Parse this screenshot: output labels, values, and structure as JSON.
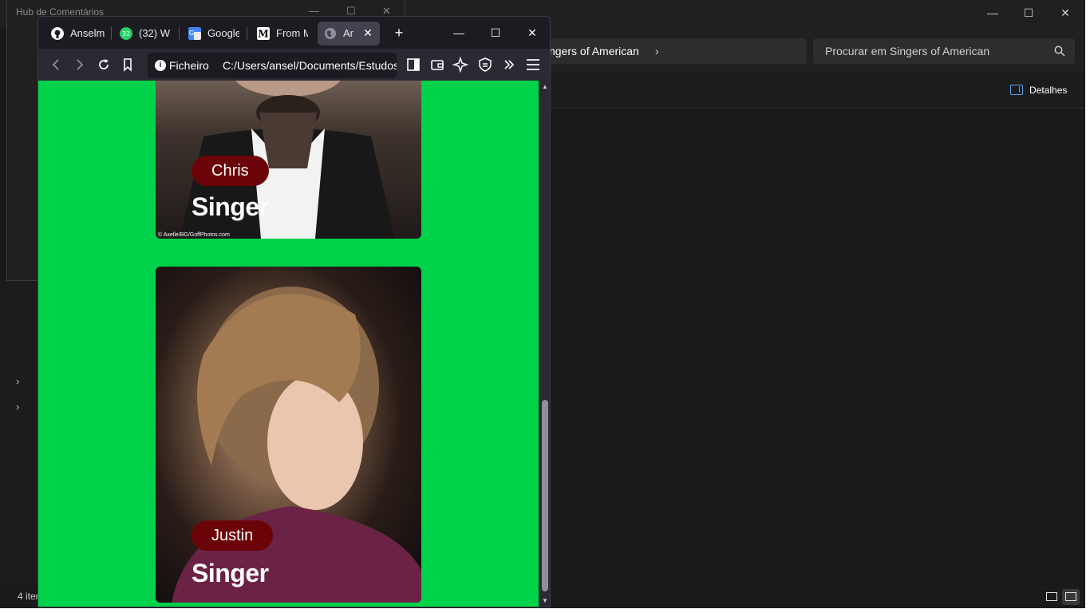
{
  "explorer": {
    "breadcrumb_current": "ngers of American",
    "breadcrumb_chevron": "›",
    "search_placeholder": "Procurar em Singers of American",
    "details_label": "Detalhes",
    "status_text": "4 iten",
    "controls": {
      "minimize": "—",
      "maximize": "☐",
      "close": "✕"
    }
  },
  "hub": {
    "title": "Hub de Comentários"
  },
  "browser": {
    "tabs": [
      {
        "label": "Anselm",
        "icon": "github-icon"
      },
      {
        "label": "(32) W",
        "icon": "whatsapp-icon"
      },
      {
        "label": "Google",
        "icon": "google-translate-icon"
      },
      {
        "label": "From M",
        "icon": "medium-icon"
      },
      {
        "label": "Ar",
        "icon": "globe-icon",
        "active": true
      }
    ],
    "tab_close": "✕",
    "new_tab": "+",
    "controls": {
      "minimize": "—",
      "maximize": "☐",
      "close": "✕"
    },
    "url_protocol_label": "Ficheiro",
    "url_path": "C:/Users/ansel/Documents/Estudos",
    "nav_icons": [
      "back-icon",
      "forward-icon",
      "reload-icon",
      "bookmark-icon",
      "sidebar-icon",
      "wallet-icon",
      "ai-sparkle-icon",
      "vpn-shield-icon",
      "overflow-icon",
      "menu-icon"
    ]
  },
  "page": {
    "cards": [
      {
        "name": "Chris",
        "role": "Singer",
        "credit": "© Axelle/BG/GoffPhotos.com"
      },
      {
        "name": "Justin",
        "role": "Singer"
      }
    ],
    "background_color": "#00d24a",
    "pill_color": "#6b0408"
  }
}
